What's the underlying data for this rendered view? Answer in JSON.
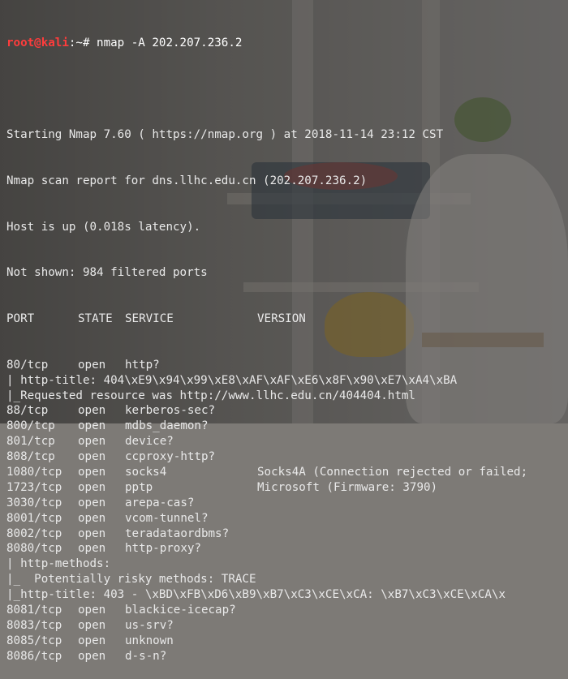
{
  "prompt": {
    "user_host": "root@kali",
    "suffix": ":~# ",
    "command": "nmap -A 202.207.236.2"
  },
  "lines_top": [
    "",
    "Starting Nmap 7.60 ( https://nmap.org ) at 2018-11-14 23:12 CST",
    "Nmap scan report for dns.llhc.edu.cn (202.207.236.2)",
    "Host is up (0.018s latency).",
    "Not shown: 984 filtered ports"
  ],
  "header": {
    "port": "PORT",
    "state": "STATE",
    "service": "SERVICE",
    "version": "VERSION"
  },
  "rows": [
    {
      "port": "80/tcp",
      "state": "open",
      "service": "http?",
      "version": ""
    },
    {
      "text": "| http-title: 404\\xE9\\x94\\x99\\xE8\\xAF\\xAF\\xE6\\x8F\\x90\\xE7\\xA4\\xBA"
    },
    {
      "text": "|_Requested resource was http://www.llhc.edu.cn/404404.html"
    },
    {
      "port": "88/tcp",
      "state": "open",
      "service": "kerberos-sec?",
      "version": ""
    },
    {
      "port": "800/tcp",
      "state": "open",
      "service": "mdbs_daemon?",
      "version": ""
    },
    {
      "port": "801/tcp",
      "state": "open",
      "service": "device?",
      "version": ""
    },
    {
      "port": "808/tcp",
      "state": "open",
      "service": "ccproxy-http?",
      "version": ""
    },
    {
      "port": "1080/tcp",
      "state": "open",
      "service": "socks4",
      "version": "Socks4A (Connection rejected or failed;"
    },
    {
      "port": "1723/tcp",
      "state": "open",
      "service": "pptp",
      "version": "Microsoft (Firmware: 3790)"
    },
    {
      "port": "3030/tcp",
      "state": "open",
      "service": "arepa-cas?",
      "version": ""
    },
    {
      "port": "8001/tcp",
      "state": "open",
      "service": "vcom-tunnel?",
      "version": ""
    },
    {
      "port": "8002/tcp",
      "state": "open",
      "service": "teradataordbms?",
      "version": ""
    },
    {
      "port": "8080/tcp",
      "state": "open",
      "service": "http-proxy?",
      "version": ""
    },
    {
      "text": "| http-methods:"
    },
    {
      "text": "|_  Potentially risky methods: TRACE"
    },
    {
      "text": "|_http-title: 403 - \\xBD\\xFB\\xD6\\xB9\\xB7\\xC3\\xCE\\xCA: \\xB7\\xC3\\xCE\\xCA\\x"
    },
    {
      "port": "8081/tcp",
      "state": "open",
      "service": "blackice-icecap?",
      "version": ""
    },
    {
      "port": "8083/tcp",
      "state": "open",
      "service": "us-srv?",
      "version": ""
    },
    {
      "port": "8085/tcp",
      "state": "open",
      "service": "unknown",
      "version": ""
    },
    {
      "port": "8086/tcp",
      "state": "open",
      "service": "d-s-n?",
      "version": ""
    }
  ],
  "colors": {
    "prompt_user": "#ff3c3c",
    "text": "#e9e9e9"
  }
}
